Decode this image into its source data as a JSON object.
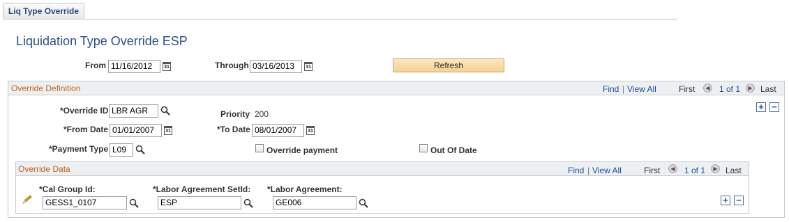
{
  "tab": {
    "label": "Liq Type Override"
  },
  "page_title": "Liquidation Type Override ESP",
  "filter": {
    "from_label": "From",
    "from_value": "11/16/2012",
    "through_label": "Through",
    "through_value": "03/16/2013",
    "refresh_label": "Refresh"
  },
  "override_definition": {
    "title": "Override Definition",
    "find": "Find",
    "view_all": "View All",
    "sep": "|",
    "first": "First",
    "counter": "1 of 1",
    "last": "Last",
    "override_id_label": "*Override ID",
    "override_id_value": "LBR AGR",
    "priority_label": "Priority",
    "priority_value": "200",
    "from_date_label": "*From Date",
    "from_date_value": "01/01/2007",
    "to_date_label": "*To Date",
    "to_date_value": "08/01/2007",
    "payment_type_label": "*Payment Type",
    "payment_type_value": "L09",
    "override_payment_label": "Override payment",
    "out_of_date_label": "Out Of Date"
  },
  "override_data": {
    "title": "Override Data",
    "find": "Find",
    "view_all": "View All",
    "sep": "|",
    "first": "First",
    "counter": "1 of 1",
    "last": "Last",
    "cal_group_label": "*Cal Group Id:",
    "cal_group_value": "GESS1_0107",
    "setid_label": "*Labor Agreement SetId:",
    "setid_value": "ESP",
    "agreement_label": "*Labor Agreement:",
    "agreement_value": "GE006"
  },
  "icons": {
    "plus": "+",
    "minus": "−",
    "cal_glyph": "31",
    "prev": "◀",
    "next": "▶"
  }
}
